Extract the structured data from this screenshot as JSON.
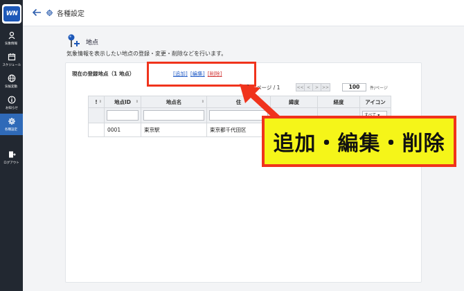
{
  "sidebar": {
    "logo_text": "WN",
    "items": [
      {
        "label": "気象情報",
        "icon": "weather-person-icon"
      },
      {
        "label": "スケジュール",
        "icon": "calendar-icon"
      },
      {
        "label": "気候変動",
        "icon": "globe-icon"
      },
      {
        "label": "お知らせ",
        "icon": "info-icon"
      },
      {
        "label": "各種設定",
        "icon": "gear-icon"
      },
      {
        "label": "ログアウト",
        "icon": "logout-icon"
      }
    ],
    "active_color": "#2f6ab8"
  },
  "header": {
    "title": "各種設定"
  },
  "section": {
    "title": "地点",
    "description": "気象情報を表示したい地点の登録・変更・削除などを行います。"
  },
  "panel": {
    "registered_label": "現在の登録地点（1 地点）",
    "add_label": "[追加]",
    "edit_label": "[編集]",
    "delete_label": "[削除]",
    "pager": {
      "current_page": "1",
      "page_text": "ページ / 1",
      "first": "<<",
      "prev": "<",
      "next": ">",
      "last": ">>",
      "per_page_value": "100",
      "per_page_label": "件/ページ"
    },
    "table": {
      "columns": [
        "!",
        "地点ID",
        "地点名",
        "住",
        "緯度",
        "経度",
        "アイコン"
      ],
      "icon_filter_value": "すべて",
      "rows": [
        {
          "flag": "",
          "id": "0001",
          "name": "東京駅",
          "address": "東京都千代田区"
        }
      ]
    }
  },
  "callout": {
    "text": "追加・編集・削除"
  },
  "colors": {
    "highlight_red": "#f0331c",
    "callout_yellow": "#f5f519",
    "link_blue": "#2a62c9",
    "link_red": "#d23b3b"
  }
}
